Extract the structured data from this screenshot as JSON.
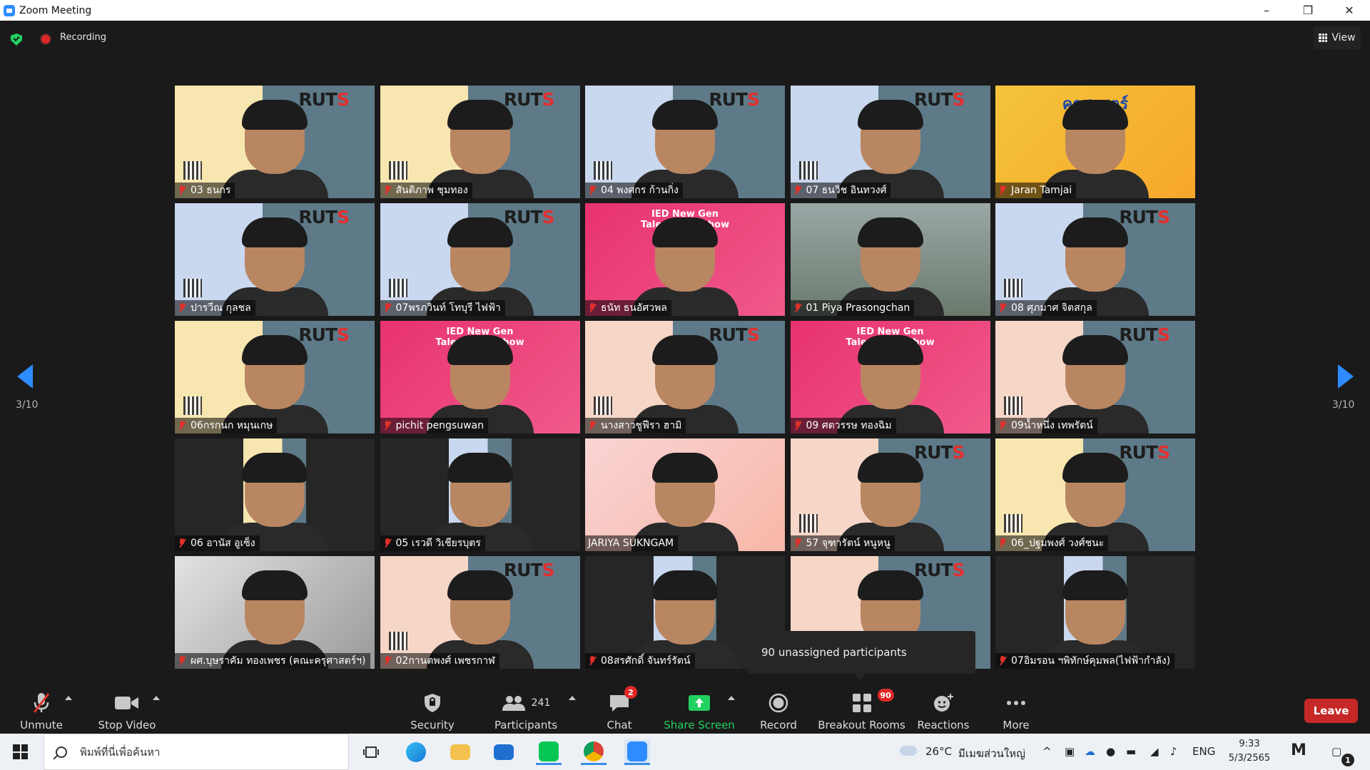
{
  "window": {
    "title": "Zoom Meeting"
  },
  "topbar": {
    "recording_label": "Recording",
    "view_label": "View"
  },
  "pagination": {
    "left_indicator": "3/10",
    "right_indicator": "3/10"
  },
  "participants_grid": [
    {
      "name": "03 ธนกร",
      "background": "yellow",
      "muted": true
    },
    {
      "name": "สันติภาพ ชุมทอง",
      "background": "yellow",
      "muted": true
    },
    {
      "name": "04 พงศกร ก้านกิ่ง",
      "background": "blue",
      "muted": true
    },
    {
      "name": "07 ธนวิช อินทวงศ์",
      "background": "blue",
      "muted": true
    },
    {
      "name": "Jaran Tamjai",
      "background": "orange",
      "muted": true
    },
    {
      "name": "ปารวีณ กุลชล",
      "background": "blue",
      "muted": true
    },
    {
      "name": "07พรภวินท์ โทบุรี ไฟฟ้า",
      "background": "blue",
      "muted": true
    },
    {
      "name": "ธนัท ธนอัศวพล",
      "background": "pink",
      "muted": true
    },
    {
      "name": "01 Piya Prasongchan",
      "background": "city",
      "muted": true
    },
    {
      "name": "08 ศุภมาศ จิตสกุล",
      "background": "blue",
      "muted": true
    },
    {
      "name": "06กรกนก หมุนเกษ",
      "background": "yellow",
      "muted": true
    },
    {
      "name": "pichit pengsuwan",
      "background": "pink",
      "muted": true
    },
    {
      "name": "นางสาวชูฟีรา ฮามิ",
      "background": "peach",
      "muted": true
    },
    {
      "name": "09 ศตวรรษ ทองฉิม",
      "background": "pink",
      "muted": true
    },
    {
      "name": "09น้ำหนึ่ง เทพรัตน์",
      "background": "peach",
      "muted": true
    },
    {
      "name": "06 อานัส อูเซ็ง",
      "background": "dark-yellow",
      "muted": true
    },
    {
      "name": "05 เรวดี วิเชียรบุตร",
      "background": "dark-blue",
      "muted": true
    },
    {
      "name": "JARIYA SUKNGAM",
      "background": "pinkpastel",
      "muted": false
    },
    {
      "name": "57 จุฑารัตน์ หนูหนู",
      "background": "peach",
      "muted": true
    },
    {
      "name": "06_ปฐมพงศ์ วงศ์ชนะ",
      "background": "yellow",
      "muted": true
    },
    {
      "name": "ผศ.บุษราคัม ทองเพชร (คณะครุศาสตร์ฯ)",
      "background": "office",
      "muted": true
    },
    {
      "name": "02กานตพงศ์ เพชรกาฬ",
      "background": "peach",
      "muted": true
    },
    {
      "name": "08สรศักดิ์ จันทร์รัตน์",
      "background": "dark-blue",
      "muted": true
    },
    {
      "name": "",
      "background": "peach",
      "muted": false
    },
    {
      "name": "07อิมรอน ฯพิทักษ์คุมพล(ไฟฟ้ากำลัง)",
      "background": "dark-blue",
      "muted": true
    }
  ],
  "tile_overlay": {
    "rut_logo_text": "RUT",
    "rut_logo_accent": "S",
    "banner_ied": "IED New Gen Talent Roadshow",
    "banner_orange": "ครุศาสตร์"
  },
  "breakout_tooltip": {
    "text": "90 unassigned participants"
  },
  "toolbar": {
    "unmute_label": "Unmute",
    "stop_video_label": "Stop Video",
    "security_label": "Security",
    "participants_label": "Participants",
    "participants_count": "241",
    "chat_label": "Chat",
    "chat_badge": "2",
    "share_screen_label": "Share Screen",
    "record_label": "Record",
    "breakout_label": "Breakout Rooms",
    "breakout_badge": "90",
    "reactions_label": "Reactions",
    "more_label": "More",
    "leave_label": "Leave"
  },
  "taskbar": {
    "search_placeholder": "พิมพ์ที่นี่เพื่อค้นหา",
    "weather_temp": "26°C",
    "weather_text": "มีเมฆส่วนใหญ่",
    "language": "ENG",
    "time": "9:33",
    "date": "5/3/2565",
    "notification_count": "1"
  },
  "colors": {
    "accent": "#2d8cff",
    "leave": "#c62828",
    "recording": "#e02828",
    "share": "#23d160",
    "muted_mic": "#e0302c"
  }
}
